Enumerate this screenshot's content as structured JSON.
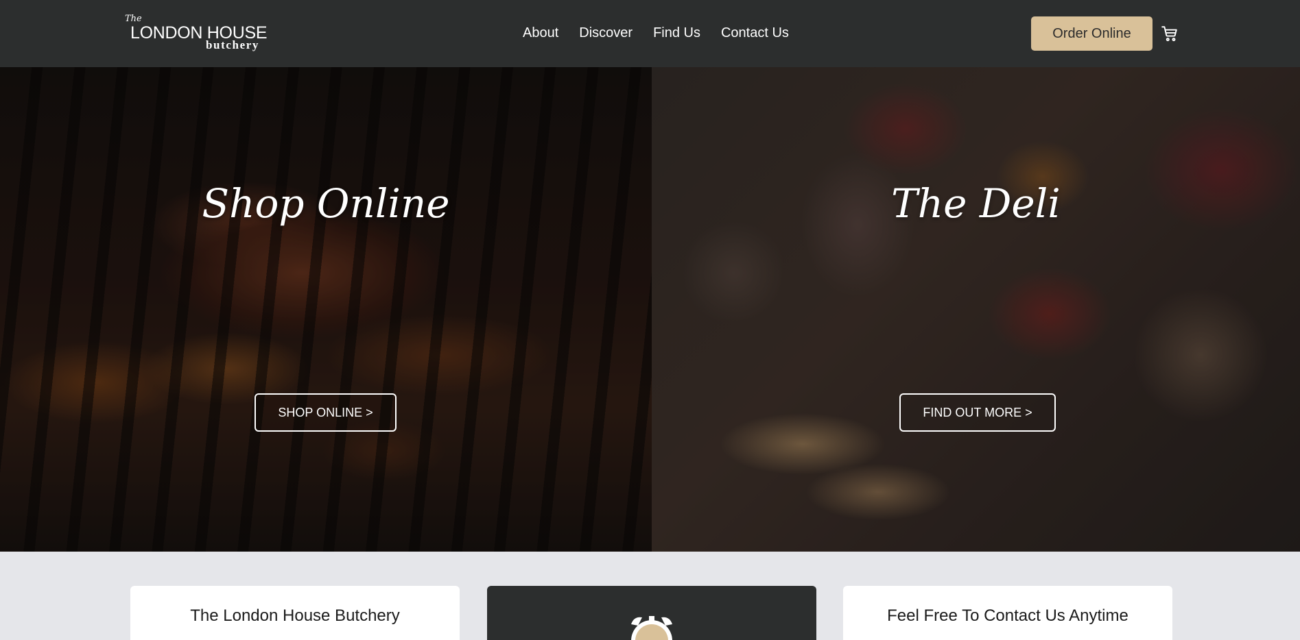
{
  "header": {
    "logo": {
      "the": "The",
      "name": "LONDON HOUSE",
      "sub": "butchery"
    },
    "nav": [
      "About",
      "Discover",
      "Find Us",
      "Contact Us"
    ],
    "order_button": "Order Online",
    "cart_icon": "cart-icon"
  },
  "hero": {
    "left": {
      "title": "Shop Online",
      "button": "SHOP ONLINE >"
    },
    "right": {
      "title": "The Deli",
      "button": "FIND OUT MORE >"
    }
  },
  "cards": [
    {
      "title": "The London House Butchery"
    },
    {
      "icon": "alarm-clock-icon"
    },
    {
      "title": "Feel Free To Contact Us Anytime"
    }
  ],
  "colors": {
    "header_bg": "#2c2e2e",
    "accent": "#d9c199",
    "page_bg": "#e5e6ea"
  }
}
